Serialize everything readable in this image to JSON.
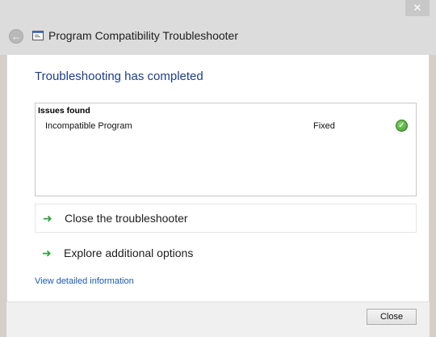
{
  "window": {
    "title": "Program Compatibility Troubleshooter",
    "close_glyph": "✕"
  },
  "back_glyph": "←",
  "heading": "Troubleshooting has completed",
  "issues": {
    "title": "Issues found",
    "rows": [
      {
        "name": "Incompatible Program",
        "status": "Fixed",
        "icon": "check-icon"
      }
    ]
  },
  "options": [
    {
      "label": "Close the troubleshooter",
      "icon": "green-arrow-icon"
    },
    {
      "label": "Explore additional options",
      "icon": "green-arrow-icon"
    }
  ],
  "arrow_glyph": "➜",
  "detail_link": "View detailed information",
  "footer": {
    "close_label": "Close"
  },
  "colors": {
    "heading": "#1a3e8a",
    "link": "#1a5bb5",
    "arrow": "#2da33b",
    "check": "#3d9b2a"
  }
}
